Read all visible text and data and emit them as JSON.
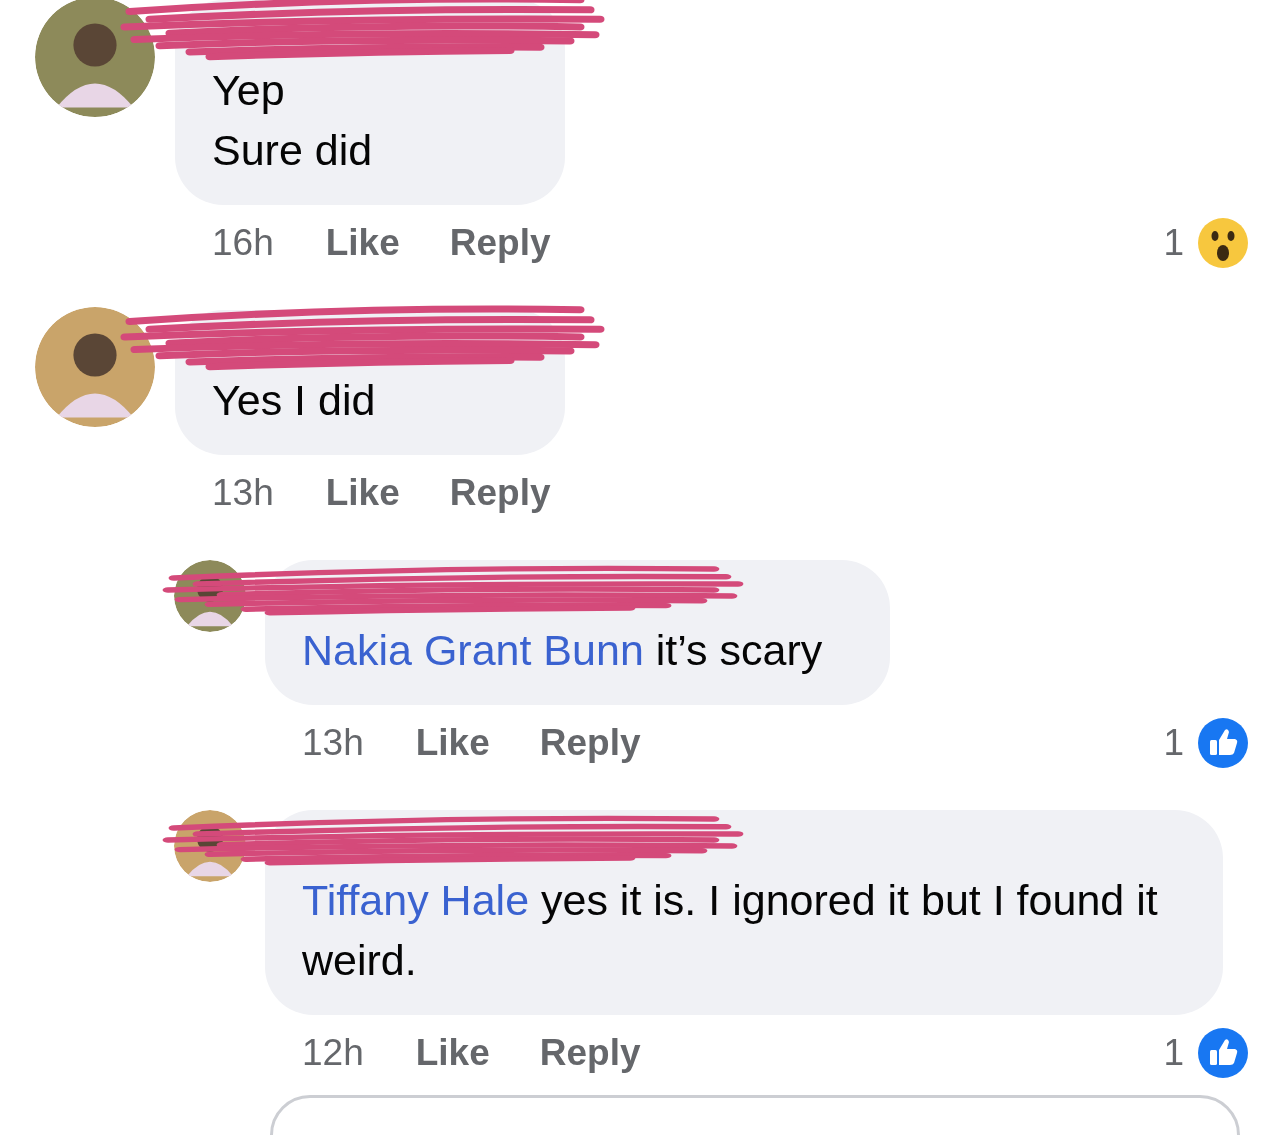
{
  "comments": [
    {
      "kind": "comment",
      "lines": [
        {
          "text": "Yep"
        },
        {
          "text": "Sure did"
        }
      ],
      "time": "16h",
      "like": "Like",
      "reply": "Reply",
      "reaction": {
        "kind": "wow",
        "count": "1"
      }
    },
    {
      "kind": "comment",
      "lines": [
        {
          "text": "Yes I did"
        }
      ],
      "time": "13h",
      "like": "Like",
      "reply": "Reply"
    },
    {
      "kind": "reply",
      "lines": [
        {
          "mention": "Nakia Grant Bunn",
          "text": " it’s scary"
        }
      ],
      "time": "13h",
      "like": "Like",
      "reply": "Reply",
      "reaction": {
        "kind": "like",
        "count": "1"
      }
    },
    {
      "kind": "reply",
      "lines": [
        {
          "mention": "Tiffany Hale",
          "text": " yes it is. I ignored it but I found it weird."
        }
      ],
      "time": "12h",
      "like": "Like",
      "reply": "Reply",
      "reaction": {
        "kind": "like",
        "count": "1"
      }
    }
  ]
}
